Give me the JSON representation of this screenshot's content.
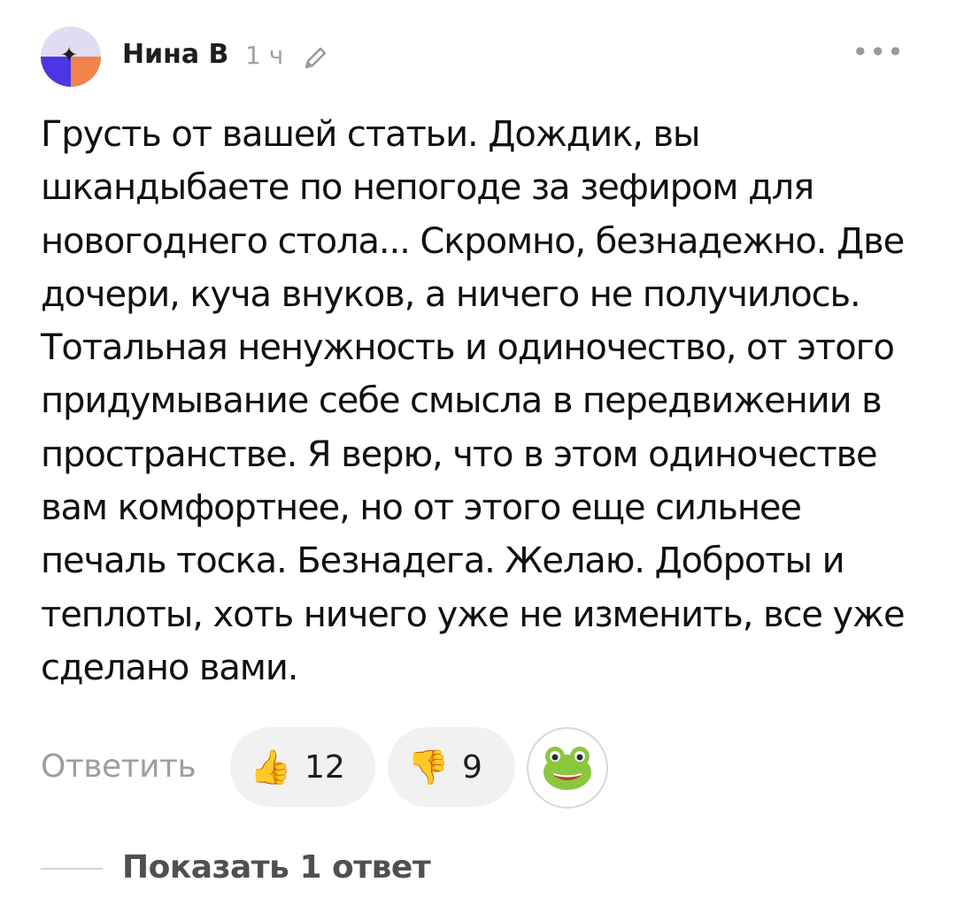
{
  "comment": {
    "author": "Нина В",
    "time": "1 ч",
    "text": "Грусть от вашей статьи. Дождик, вы шкандыбаете по непогоде за зефиром для новогоднего стола... Скромно, безнадежно. Две дочери, куча внуков, а ничего не получилось. Тотальная ненужность и одиночество, от этого придумывание себе смысла в передвижении в пространстве. Я верю, что в этом одиночестве вам комфортнее, но от этого еще сильнее печаль тоска. Безнадега. Желаю. Доброты и теплоты, хоть ничего уже не изменить, все уже сделано вами.",
    "icons": {
      "edit": "pencil-icon",
      "more": "more-dots-icon",
      "like": "thumbs-up-icon",
      "dislike": "thumbs-down-icon",
      "reaction": "frog-emoji-icon"
    }
  },
  "actions": {
    "reply_label": "Ответить",
    "likes": "12",
    "dislikes": "9",
    "like_emoji": "👍",
    "dislike_emoji": "👎",
    "more_dots": "•••"
  },
  "replies": {
    "show_label": "Показать 1 ответ"
  },
  "colors": {
    "avatar_top": "#e1dbf3",
    "avatar_bottom": "#4a37e3",
    "avatar_orange": "#f0824b",
    "muted_text": "#9e9e9e",
    "pill_bg": "#f1f1f1"
  }
}
